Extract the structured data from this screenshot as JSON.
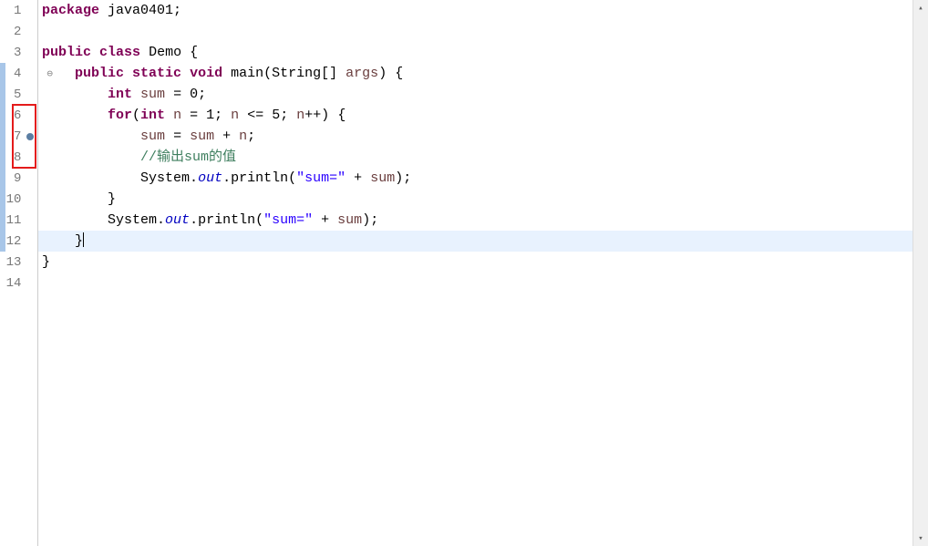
{
  "lines": [
    {
      "num": "1",
      "marker": "none",
      "bluebar": false
    },
    {
      "num": "2",
      "marker": "none",
      "bluebar": false
    },
    {
      "num": "3",
      "marker": "none",
      "bluebar": false
    },
    {
      "num": "4",
      "marker": "override",
      "bluebar": true
    },
    {
      "num": "5",
      "marker": "none",
      "bluebar": true
    },
    {
      "num": "6",
      "marker": "none",
      "bluebar": true
    },
    {
      "num": "7",
      "marker": "breakpoint",
      "bluebar": true
    },
    {
      "num": "8",
      "marker": "none",
      "bluebar": true
    },
    {
      "num": "9",
      "marker": "none",
      "bluebar": true
    },
    {
      "num": "10",
      "marker": "none",
      "bluebar": true
    },
    {
      "num": "11",
      "marker": "none",
      "bluebar": true
    },
    {
      "num": "12",
      "marker": "none",
      "bluebar": true,
      "current": true
    },
    {
      "num": "13",
      "marker": "none",
      "bluebar": false
    },
    {
      "num": "14",
      "marker": "none",
      "bluebar": false
    }
  ],
  "code": {
    "l1": {
      "prefix": "",
      "kw1": "package",
      "sp1": " ",
      "pkg": "java0401",
      "end": ";"
    },
    "l2": {
      "blank": ""
    },
    "l3": {
      "kw1": "public",
      "sp1": " ",
      "kw2": "class",
      "sp2": " ",
      "name": "Demo",
      "sp3": " ",
      "brace": "{"
    },
    "l4": {
      "indent": "    ",
      "kw1": "public",
      "sp1": " ",
      "kw2": "static",
      "sp2": " ",
      "kw3": "void",
      "sp3": " ",
      "method": "main",
      "paren1": "(",
      "type": "String",
      "arr": "[] ",
      "arg": "args",
      "paren2": ") ",
      "brace": "{"
    },
    "l5": {
      "indent": "        ",
      "type": "int",
      "sp": " ",
      "var": "sum",
      "sp2": " ",
      "eq": "=",
      "sp3": " ",
      "val": "0",
      "end": ";"
    },
    "l6": {
      "indent": "        ",
      "kw": "for",
      "paren": "(",
      "type": "int",
      "sp": " ",
      "var": "n",
      "sp2": " ",
      "eq": "=",
      "sp3": " ",
      "val1": "1",
      "semi1": "; ",
      "var2": "n",
      "sp4": " ",
      "op": "<=",
      "sp5": " ",
      "val2": "5",
      "semi2": "; ",
      "var3": "n",
      "inc": "++",
      "paren2": ") ",
      "brace": "{"
    },
    "l7": {
      "indent": "            ",
      "var1": "sum",
      "sp1": " ",
      "eq": "=",
      "sp2": " ",
      "var2": "sum",
      "sp3": " ",
      "op": "+",
      "sp4": " ",
      "var3": "n",
      "end": ";"
    },
    "l8": {
      "indent": "            ",
      "comment": "//输出sum的值"
    },
    "l9": {
      "indent": "            ",
      "cls": "System",
      "dot1": ".",
      "fld": "out",
      "dot2": ".",
      "meth": "println",
      "paren1": "(",
      "str": "\"sum=\"",
      "sp1": " ",
      "op": "+",
      "sp2": " ",
      "var": "sum",
      "paren2": ")",
      "end": ";"
    },
    "l10": {
      "indent": "        ",
      "brace": "}"
    },
    "l11": {
      "indent": "        ",
      "cls": "System",
      "dot1": ".",
      "fld": "out",
      "dot2": ".",
      "meth": "println",
      "paren1": "(",
      "str": "\"sum=\"",
      "sp1": " ",
      "op": "+",
      "sp2": " ",
      "var": "sum",
      "paren2": ")",
      "end": ";"
    },
    "l12": {
      "indent": "    ",
      "brace": "}"
    },
    "l13": {
      "brace": "}"
    },
    "l14": {
      "blank": ""
    }
  }
}
